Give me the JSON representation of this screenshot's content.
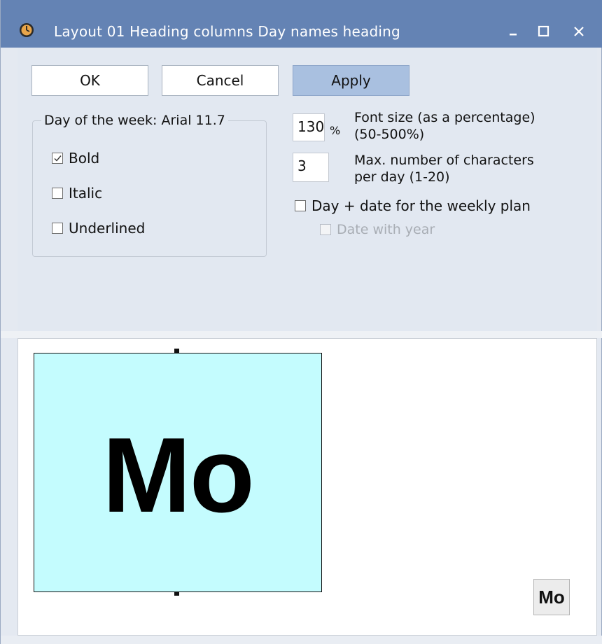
{
  "window": {
    "title": "Layout 01  Heading columns  Day names heading",
    "icon": "clock-icon",
    "controls": [
      "minimize-icon",
      "maximize-icon",
      "close-icon"
    ]
  },
  "buttons": {
    "ok": "OK",
    "cancel": "Cancel",
    "apply": "Apply"
  },
  "group": {
    "label": "Day of the week: Arial 11.7",
    "bold": {
      "label": "Bold",
      "checked": true
    },
    "italic": {
      "label": "Italic",
      "checked": false
    },
    "underlined": {
      "label": "Underlined",
      "checked": false
    }
  },
  "font_size": {
    "value": "130",
    "unit": "%",
    "label_line1": "Font size (as a percentage)",
    "label_line2": "(50-500%)"
  },
  "max_chars": {
    "value": "3",
    "label_line1": "Max. number of characters",
    "label_line2": "per day (1-20)"
  },
  "day_date": {
    "label": "Day + date for the weekly plan",
    "checked": false
  },
  "date_year": {
    "label": "Date with year",
    "checked": false,
    "disabled": true
  },
  "preview": {
    "cell_text": "Mo",
    "cell_color": "#c4fcfe",
    "button_text": "Mo"
  },
  "colors": {
    "titlebar": "#6483b4",
    "apply": "#a9c0e0",
    "panel": "#e2e8f1"
  }
}
